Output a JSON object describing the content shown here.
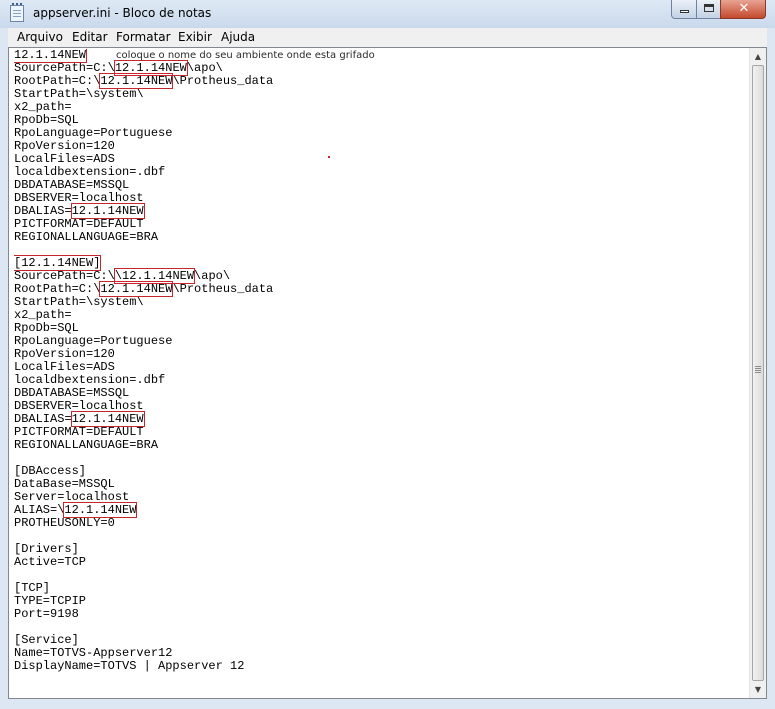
{
  "window": {
    "title": "appserver.ini - Bloco de notas",
    "controls": {
      "minimize": "minimize",
      "maximize": "maximize",
      "close": "✕"
    }
  },
  "menu": [
    "Arquivo",
    "Editar",
    "Formatar",
    "Exibir",
    "Ajuda"
  ],
  "annotation": "coloque o nome do seu ambiente onde esta grifado",
  "highlight_color": "#c8262d",
  "editor": {
    "lines": [
      [
        {
          "t": "12.1.14NEW",
          "hl": true
        }
      ],
      [
        {
          "t": "SourcePath=C:\\"
        },
        {
          "t": "12.1.14NEW",
          "hl": true
        },
        {
          "t": "\\apo\\"
        }
      ],
      [
        {
          "t": "RootPath=C:\\"
        },
        {
          "t": "12.1.14NEW",
          "hl": true
        },
        {
          "t": "\\Protheus_data"
        }
      ],
      [
        {
          "t": "StartPath=\\system\\"
        }
      ],
      [
        {
          "t": "x2_path="
        }
      ],
      [
        {
          "t": "RpoDb=SQL"
        }
      ],
      [
        {
          "t": "RpoLanguage=Portuguese"
        }
      ],
      [
        {
          "t": "RpoVersion=120"
        }
      ],
      [
        {
          "t": "LocalFiles=ADS"
        }
      ],
      [
        {
          "t": "localdbextension=.dbf"
        }
      ],
      [
        {
          "t": "DBDATABASE=MSSQL"
        }
      ],
      [
        {
          "t": "DBSERVER=localhost"
        }
      ],
      [
        {
          "t": "DBALIAS="
        },
        {
          "t": "12.1.14NEW",
          "hl": true
        }
      ],
      [
        {
          "t": "PICTFORMAT=DEFAULT"
        }
      ],
      [
        {
          "t": "REGIONALLANGUAGE=BRA"
        }
      ],
      [
        {
          "t": ""
        }
      ],
      [
        {
          "t": "[12.1.14NEW]",
          "hl": true
        }
      ],
      [
        {
          "t": "SourcePath=C:\\"
        },
        {
          "t": "\\12.1.14NEW",
          "hl": true
        },
        {
          "t": "\\apo\\"
        }
      ],
      [
        {
          "t": "RootPath=C:\\"
        },
        {
          "t": "12.1.14NEW",
          "hl": true
        },
        {
          "t": "\\Protheus_data"
        }
      ],
      [
        {
          "t": "StartPath=\\system\\"
        }
      ],
      [
        {
          "t": "x2_path="
        }
      ],
      [
        {
          "t": "RpoDb=SQL"
        }
      ],
      [
        {
          "t": "RpoLanguage=Portuguese"
        }
      ],
      [
        {
          "t": "RpoVersion=120"
        }
      ],
      [
        {
          "t": "LocalFiles=ADS"
        }
      ],
      [
        {
          "t": "localdbextension=.dbf"
        }
      ],
      [
        {
          "t": "DBDATABASE=MSSQL"
        }
      ],
      [
        {
          "t": "DBSERVER=localhost"
        }
      ],
      [
        {
          "t": "DBALIAS="
        },
        {
          "t": "12.1.14NEW",
          "hl": true
        }
      ],
      [
        {
          "t": "PICTFORMAT=DEFAULT"
        }
      ],
      [
        {
          "t": "REGIONALLANGUAGE=BRA"
        }
      ],
      [
        {
          "t": ""
        }
      ],
      [
        {
          "t": "[DBAccess]"
        }
      ],
      [
        {
          "t": "DataBase=MSSQL"
        }
      ],
      [
        {
          "t": "Server=localhost"
        }
      ],
      [
        {
          "t": "ALIAS=\\"
        },
        {
          "t": "12.1.14NEW",
          "hl": true
        }
      ],
      [
        {
          "t": "PROTHEUSONLY=0"
        }
      ],
      [
        {
          "t": ""
        }
      ],
      [
        {
          "t": "[Drivers]"
        }
      ],
      [
        {
          "t": "Active=TCP"
        }
      ],
      [
        {
          "t": ""
        }
      ],
      [
        {
          "t": "[TCP]"
        }
      ],
      [
        {
          "t": "TYPE=TCPIP"
        }
      ],
      [
        {
          "t": "Port=9198"
        }
      ],
      [
        {
          "t": ""
        }
      ],
      [
        {
          "t": "[Service]"
        }
      ],
      [
        {
          "t": "Name=TOTVS-Appserver12"
        }
      ],
      [
        {
          "t": "DisplayName=TOTVS | Appserver 12"
        }
      ]
    ]
  },
  "scrollbar": {
    "up": "▲",
    "down": "▼"
  }
}
